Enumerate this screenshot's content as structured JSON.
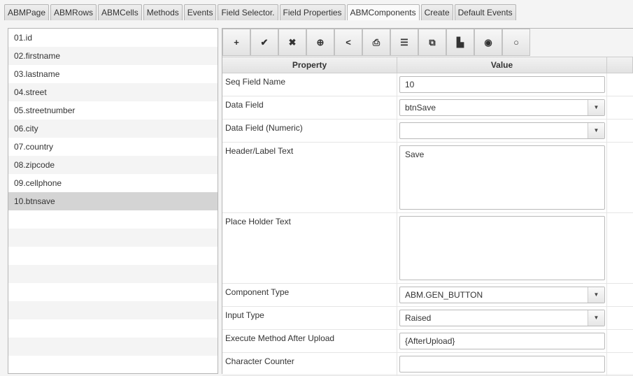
{
  "tabs": [
    "ABMPage",
    "ABMRows",
    "ABMCells",
    "Methods",
    "Events",
    "Field Selector.",
    "Field Properties",
    "ABMComponents",
    "Create",
    "Default Events"
  ],
  "active_tab": "ABMComponents",
  "fields": [
    "01.id",
    "02.firstname",
    "03.lastname",
    "04.street",
    "05.streetnumber",
    "06.city",
    "07.country",
    "08.zipcode",
    "09.cellphone",
    "10.btnsave"
  ],
  "selected_field": "10.btnsave",
  "toolbar": [
    {
      "icon": "plus-icon",
      "glyph": "+"
    },
    {
      "icon": "check-icon",
      "glyph": "✔"
    },
    {
      "icon": "close-icon",
      "glyph": "✖"
    },
    {
      "icon": "add-circle-icon",
      "glyph": "⊕"
    },
    {
      "icon": "share-icon",
      "glyph": "<"
    },
    {
      "icon": "print-icon",
      "glyph": "⎙"
    },
    {
      "icon": "list-icon",
      "glyph": "☰"
    },
    {
      "icon": "copy-icon",
      "glyph": "⧉"
    },
    {
      "icon": "paste-icon",
      "glyph": "▙"
    },
    {
      "icon": "radio-checked-icon",
      "glyph": "◉"
    },
    {
      "icon": "radio-unchecked-icon",
      "glyph": "○"
    }
  ],
  "table": {
    "headers": [
      "Property",
      "Value"
    ],
    "rows": [
      {
        "property": "Seq Field Name",
        "value": "10",
        "type": "text"
      },
      {
        "property": "Data Field",
        "value": "btnSave",
        "type": "combo"
      },
      {
        "property": "Data Field (Numeric)",
        "value": "",
        "type": "combo"
      },
      {
        "property": "Header/Label Text",
        "value": "Save",
        "type": "area"
      },
      {
        "property": "Place Holder Text",
        "value": "",
        "type": "area"
      },
      {
        "property": "Component Type",
        "value": "ABM.GEN_BUTTON",
        "type": "combo"
      },
      {
        "property": "Input Type",
        "value": "Raised",
        "type": "combo"
      },
      {
        "property": "Execute Method After Upload",
        "value": "{AfterUpload}",
        "type": "text"
      },
      {
        "property": "Character Counter",
        "value": "",
        "type": "text"
      }
    ]
  }
}
